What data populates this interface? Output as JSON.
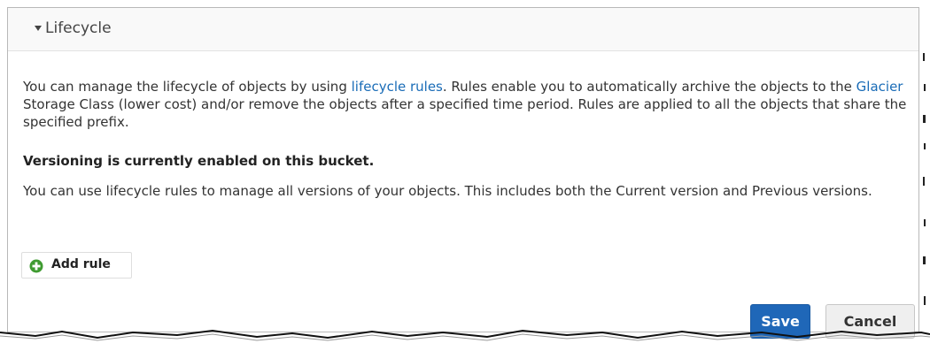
{
  "header": {
    "title": "Lifecycle"
  },
  "intro": {
    "before_link1": "You can manage the lifecycle of objects by using ",
    "link1": "lifecycle rules",
    "between": ". Rules enable you to automatically archive the objects to the ",
    "link2": "Glacier",
    "after": " Storage Class (lower cost) and/or remove the objects after a specified time period. Rules are applied to all the objects that share the specified prefix."
  },
  "versioning": {
    "status": "Versioning is currently enabled on this bucket.",
    "note": "You can use lifecycle rules to manage all versions of your objects. This includes both the Current version and Previous versions."
  },
  "add_rule": {
    "label": "Add rule",
    "icon": "plus-circle-icon",
    "icon_color": "#3f9b31"
  },
  "actions": {
    "save_label": "Save",
    "cancel_label": "Cancel",
    "save_color": "#1f67b8"
  }
}
